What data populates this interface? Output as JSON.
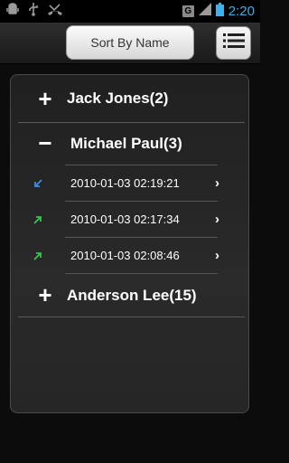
{
  "statusbar": {
    "time": "2:20",
    "g_badge": "G"
  },
  "header": {
    "sort_label": "Sort By Name"
  },
  "groups": [
    {
      "sign": "+",
      "label": "Jack Jones(2)"
    },
    {
      "sign": "−",
      "label": "Michael Paul(3)",
      "calls": [
        {
          "type": "incoming",
          "color": "#3a8fe8",
          "time": "2010-01-03 02:19:21"
        },
        {
          "type": "outgoing",
          "color": "#39c44a",
          "time": "2010-01-03 02:17:34"
        },
        {
          "type": "outgoing",
          "color": "#39c44a",
          "time": "2010-01-03 02:08:46"
        }
      ]
    },
    {
      "sign": "+",
      "label": "Anderson Lee(15)"
    }
  ],
  "chevron": "›"
}
